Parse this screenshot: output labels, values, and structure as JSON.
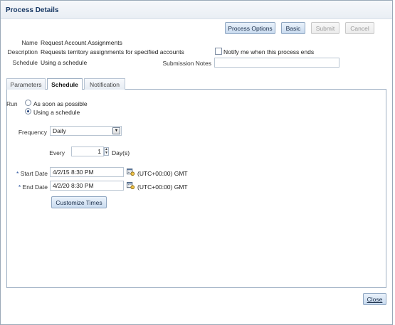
{
  "dialog": {
    "title": "Process Details"
  },
  "toolbar": {
    "process_options": "Process Options",
    "basic": "Basic",
    "submit": "Submit",
    "cancel": "Cancel"
  },
  "details": {
    "name_label": "Name",
    "name_value": "Request Account Assignments",
    "description_label": "Description",
    "description_value": "Requests territory assignments for specified accounts",
    "schedule_label": "Schedule",
    "schedule_value": "Using a schedule",
    "notify_label": "Notify me when this process ends",
    "notify_checked": false,
    "submission_notes_label": "Submission Notes",
    "submission_notes_value": ""
  },
  "tabs": [
    {
      "label": "Parameters",
      "active": false
    },
    {
      "label": "Schedule",
      "active": true
    },
    {
      "label": "Notification",
      "active": false
    }
  ],
  "schedule": {
    "run_label": "Run",
    "option_asap": "As soon as possible",
    "option_schedule": "Using a schedule",
    "selected_option": "Using a schedule",
    "frequency_label": "Frequency",
    "frequency_value": "Daily",
    "every_label": "Every",
    "every_value": "1",
    "every_unit": "Day(s)",
    "start_date_label": "Start Date",
    "start_date_value": "4/2/15 8:30 PM",
    "start_tz": "(UTC+00:00) GMT",
    "end_date_label": "End Date",
    "end_date_value": "4/2/20 8:30 PM",
    "end_tz": "(UTC+00:00) GMT",
    "required_marker": "*",
    "customize_times": "Customize Times"
  },
  "footer": {
    "close": "Close"
  },
  "icons": {
    "calendar": "calendar-icon",
    "dropdown": "chevron-down-icon",
    "stepper": "spin-arrows-icon"
  }
}
